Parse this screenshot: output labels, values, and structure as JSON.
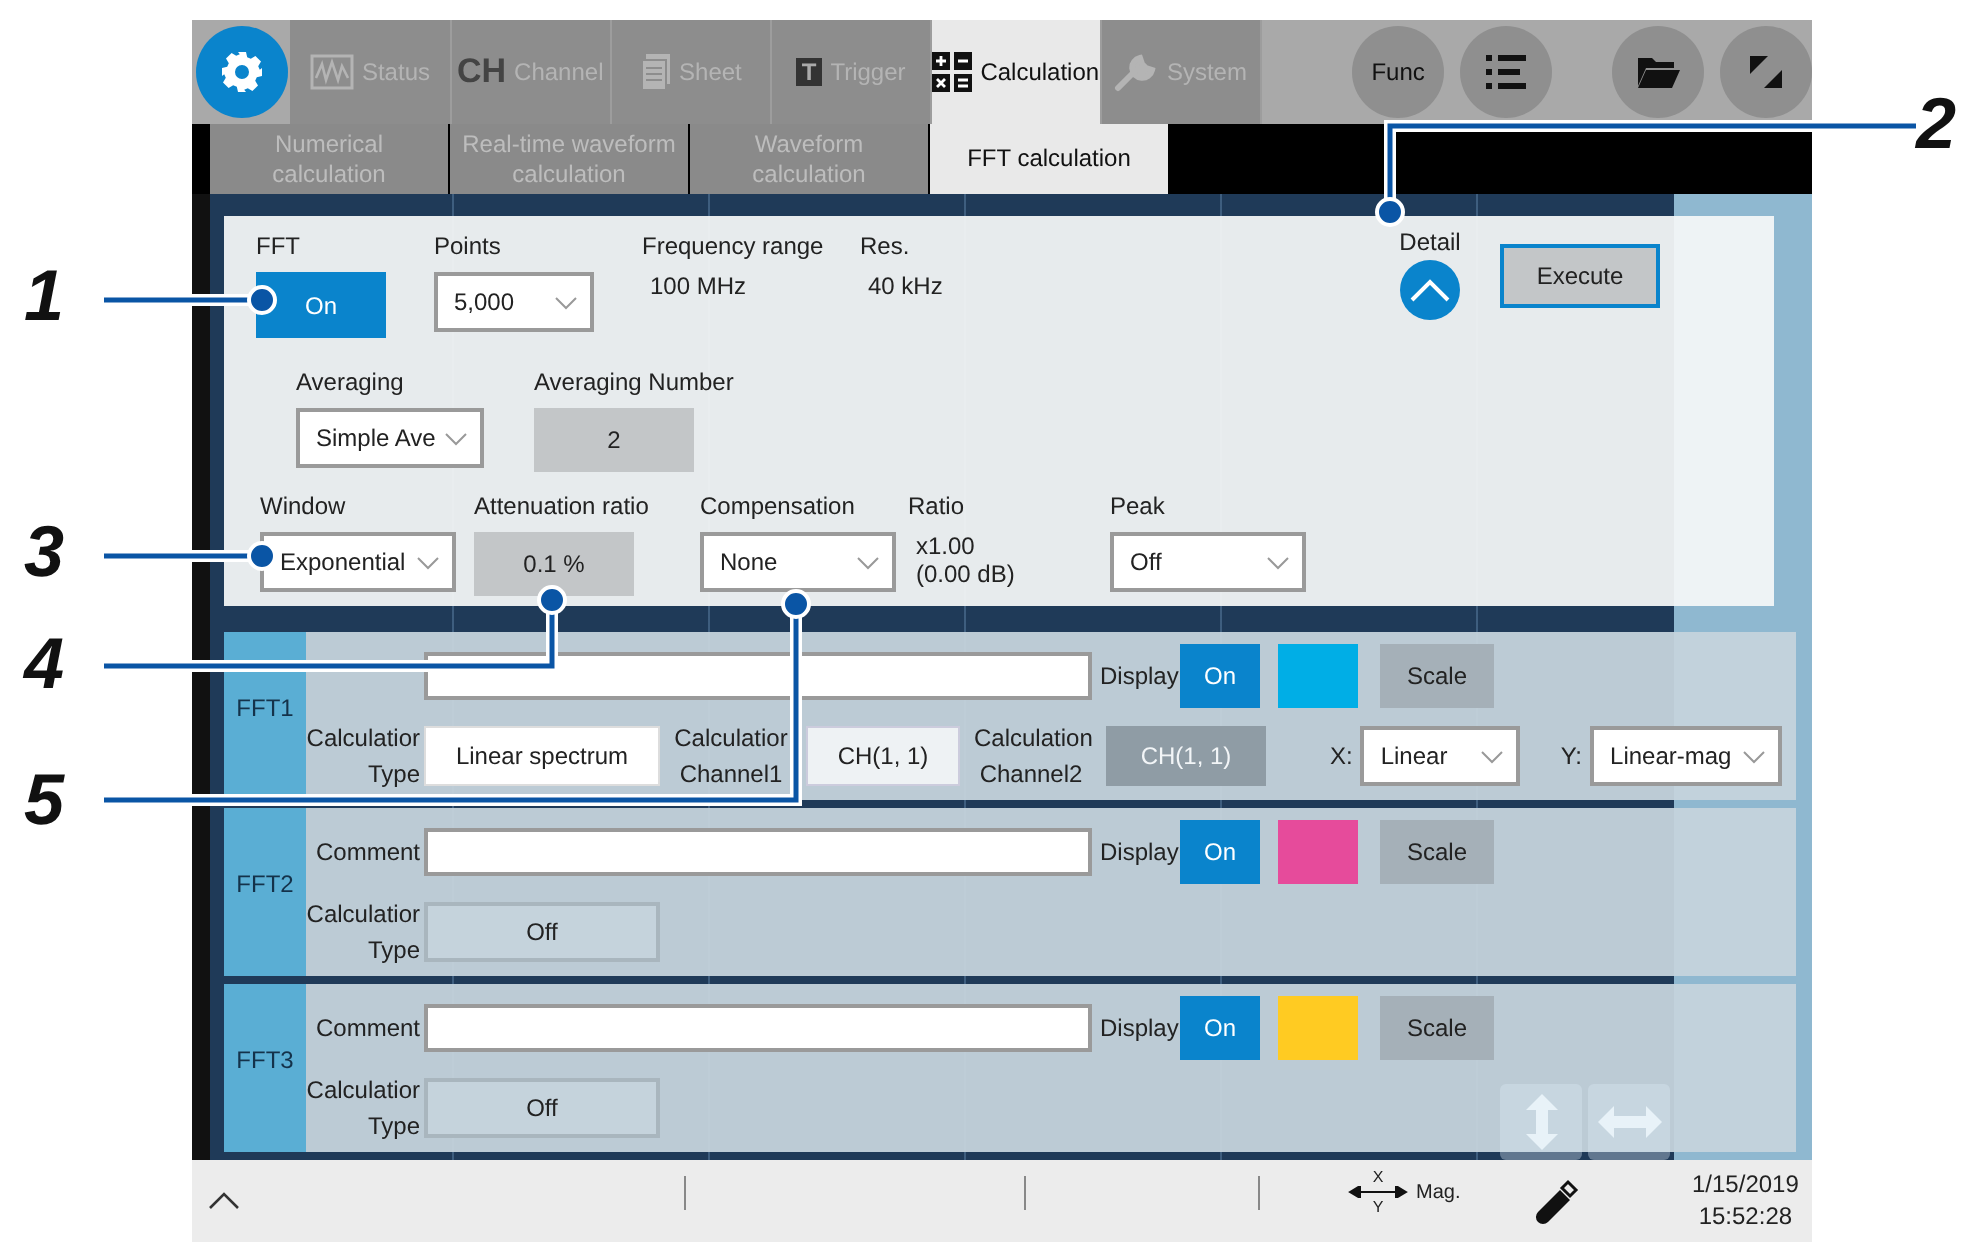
{
  "callouts": [
    {
      "number": "1"
    },
    {
      "number": "2"
    },
    {
      "number": "3"
    },
    {
      "number": "4"
    },
    {
      "number": "5"
    }
  ],
  "top_tabs": [
    {
      "kind": "status",
      "label": "Status",
      "selected": false
    },
    {
      "kind": "channel",
      "badge": "CH",
      "label": "Channel",
      "selected": false
    },
    {
      "kind": "sheet",
      "label": "Sheet",
      "selected": false
    },
    {
      "kind": "trigger",
      "badge": "T",
      "label": "Trigger",
      "selected": false
    },
    {
      "kind": "calculation",
      "label": "Calculation",
      "selected": true
    },
    {
      "kind": "system",
      "label": "System",
      "selected": false
    }
  ],
  "top_buttons": [
    {
      "kind": "func",
      "label": "Func"
    },
    {
      "kind": "list"
    },
    {
      "kind": "folder"
    },
    {
      "kind": "expand"
    }
  ],
  "sub_tabs": [
    {
      "label": "Numerical calculation",
      "selected": false
    },
    {
      "label": "Real-time waveform calculation",
      "selected": false
    },
    {
      "label": "Waveform calculation",
      "selected": false
    },
    {
      "label": "FFT calculation",
      "selected": true
    }
  ],
  "settings": [
    [
      {
        "kind": "toggle",
        "label": "FFT",
        "value": "On",
        "on": true
      },
      {
        "kind": "select",
        "label": "Points",
        "value": "5,000"
      },
      {
        "kind": "readout",
        "label": "Frequency range",
        "value_lines": [
          "100 MHz"
        ]
      },
      {
        "kind": "readout",
        "label": "Res.",
        "value_lines": [
          "40 kHz"
        ]
      },
      {
        "kind": "detail",
        "label": "Detail",
        "expanded": true
      },
      {
        "kind": "button",
        "value": "Execute"
      }
    ],
    [
      {
        "kind": "select",
        "label": "Averaging",
        "value": "Simple Ave"
      },
      {
        "kind": "number",
        "label": "Averaging Number",
        "value": "2"
      }
    ],
    [
      {
        "kind": "select",
        "label": "Window",
        "value": "Exponential"
      },
      {
        "kind": "number",
        "label": "Attenuation ratio",
        "value": "0.1 %"
      },
      {
        "kind": "select",
        "label": "Compensation",
        "value": "None"
      },
      {
        "kind": "readout",
        "label": "Ratio",
        "value_lines": [
          "x1.00",
          "(0.00 dB)"
        ]
      },
      {
        "kind": "select",
        "label": "Peak",
        "value": "Off"
      }
    ]
  ],
  "fft_rows": [
    {
      "label": "FFT1",
      "display_label": "Display",
      "display_value": "On",
      "display_on": true,
      "color": "#00aee6",
      "scale": "Scale",
      "type_label": [
        "Calculatior",
        "Type"
      ],
      "type_value": "Linear spectrum",
      "type_disabled": false,
      "channel1": {
        "label": [
          "Calculatior",
          "Channel1"
        ],
        "value": "CH(1, 1)",
        "disabled": false
      },
      "channel2": {
        "label": [
          "Calculation",
          "Channel2"
        ],
        "value": "CH(1, 1)",
        "disabled": true
      },
      "x": {
        "label": "X:",
        "value": "Linear"
      },
      "y": {
        "label": "Y:",
        "value": "Linear-mag"
      }
    },
    {
      "label": "FFT2",
      "comment_label": "Comment",
      "display_label": "Display",
      "display_value": "On",
      "display_on": true,
      "color": "#e64b9b",
      "scale": "Scale",
      "type_label": [
        "Calculatior",
        "Type"
      ],
      "type_value": "Off",
      "type_disabled": true
    },
    {
      "label": "FFT3",
      "comment_label": "Comment",
      "display_label": "Display",
      "display_value": "On",
      "display_on": true,
      "color": "#ffcb22",
      "scale": "Scale",
      "type_label": [
        "Calculatior",
        "Type"
      ],
      "type_value": "Off",
      "type_disabled": true
    }
  ],
  "status_bar": {
    "mag_axes": [
      "X",
      "Y"
    ],
    "mag_label": "Mag.",
    "date": "1/15/2019",
    "time": "15:52:28"
  }
}
